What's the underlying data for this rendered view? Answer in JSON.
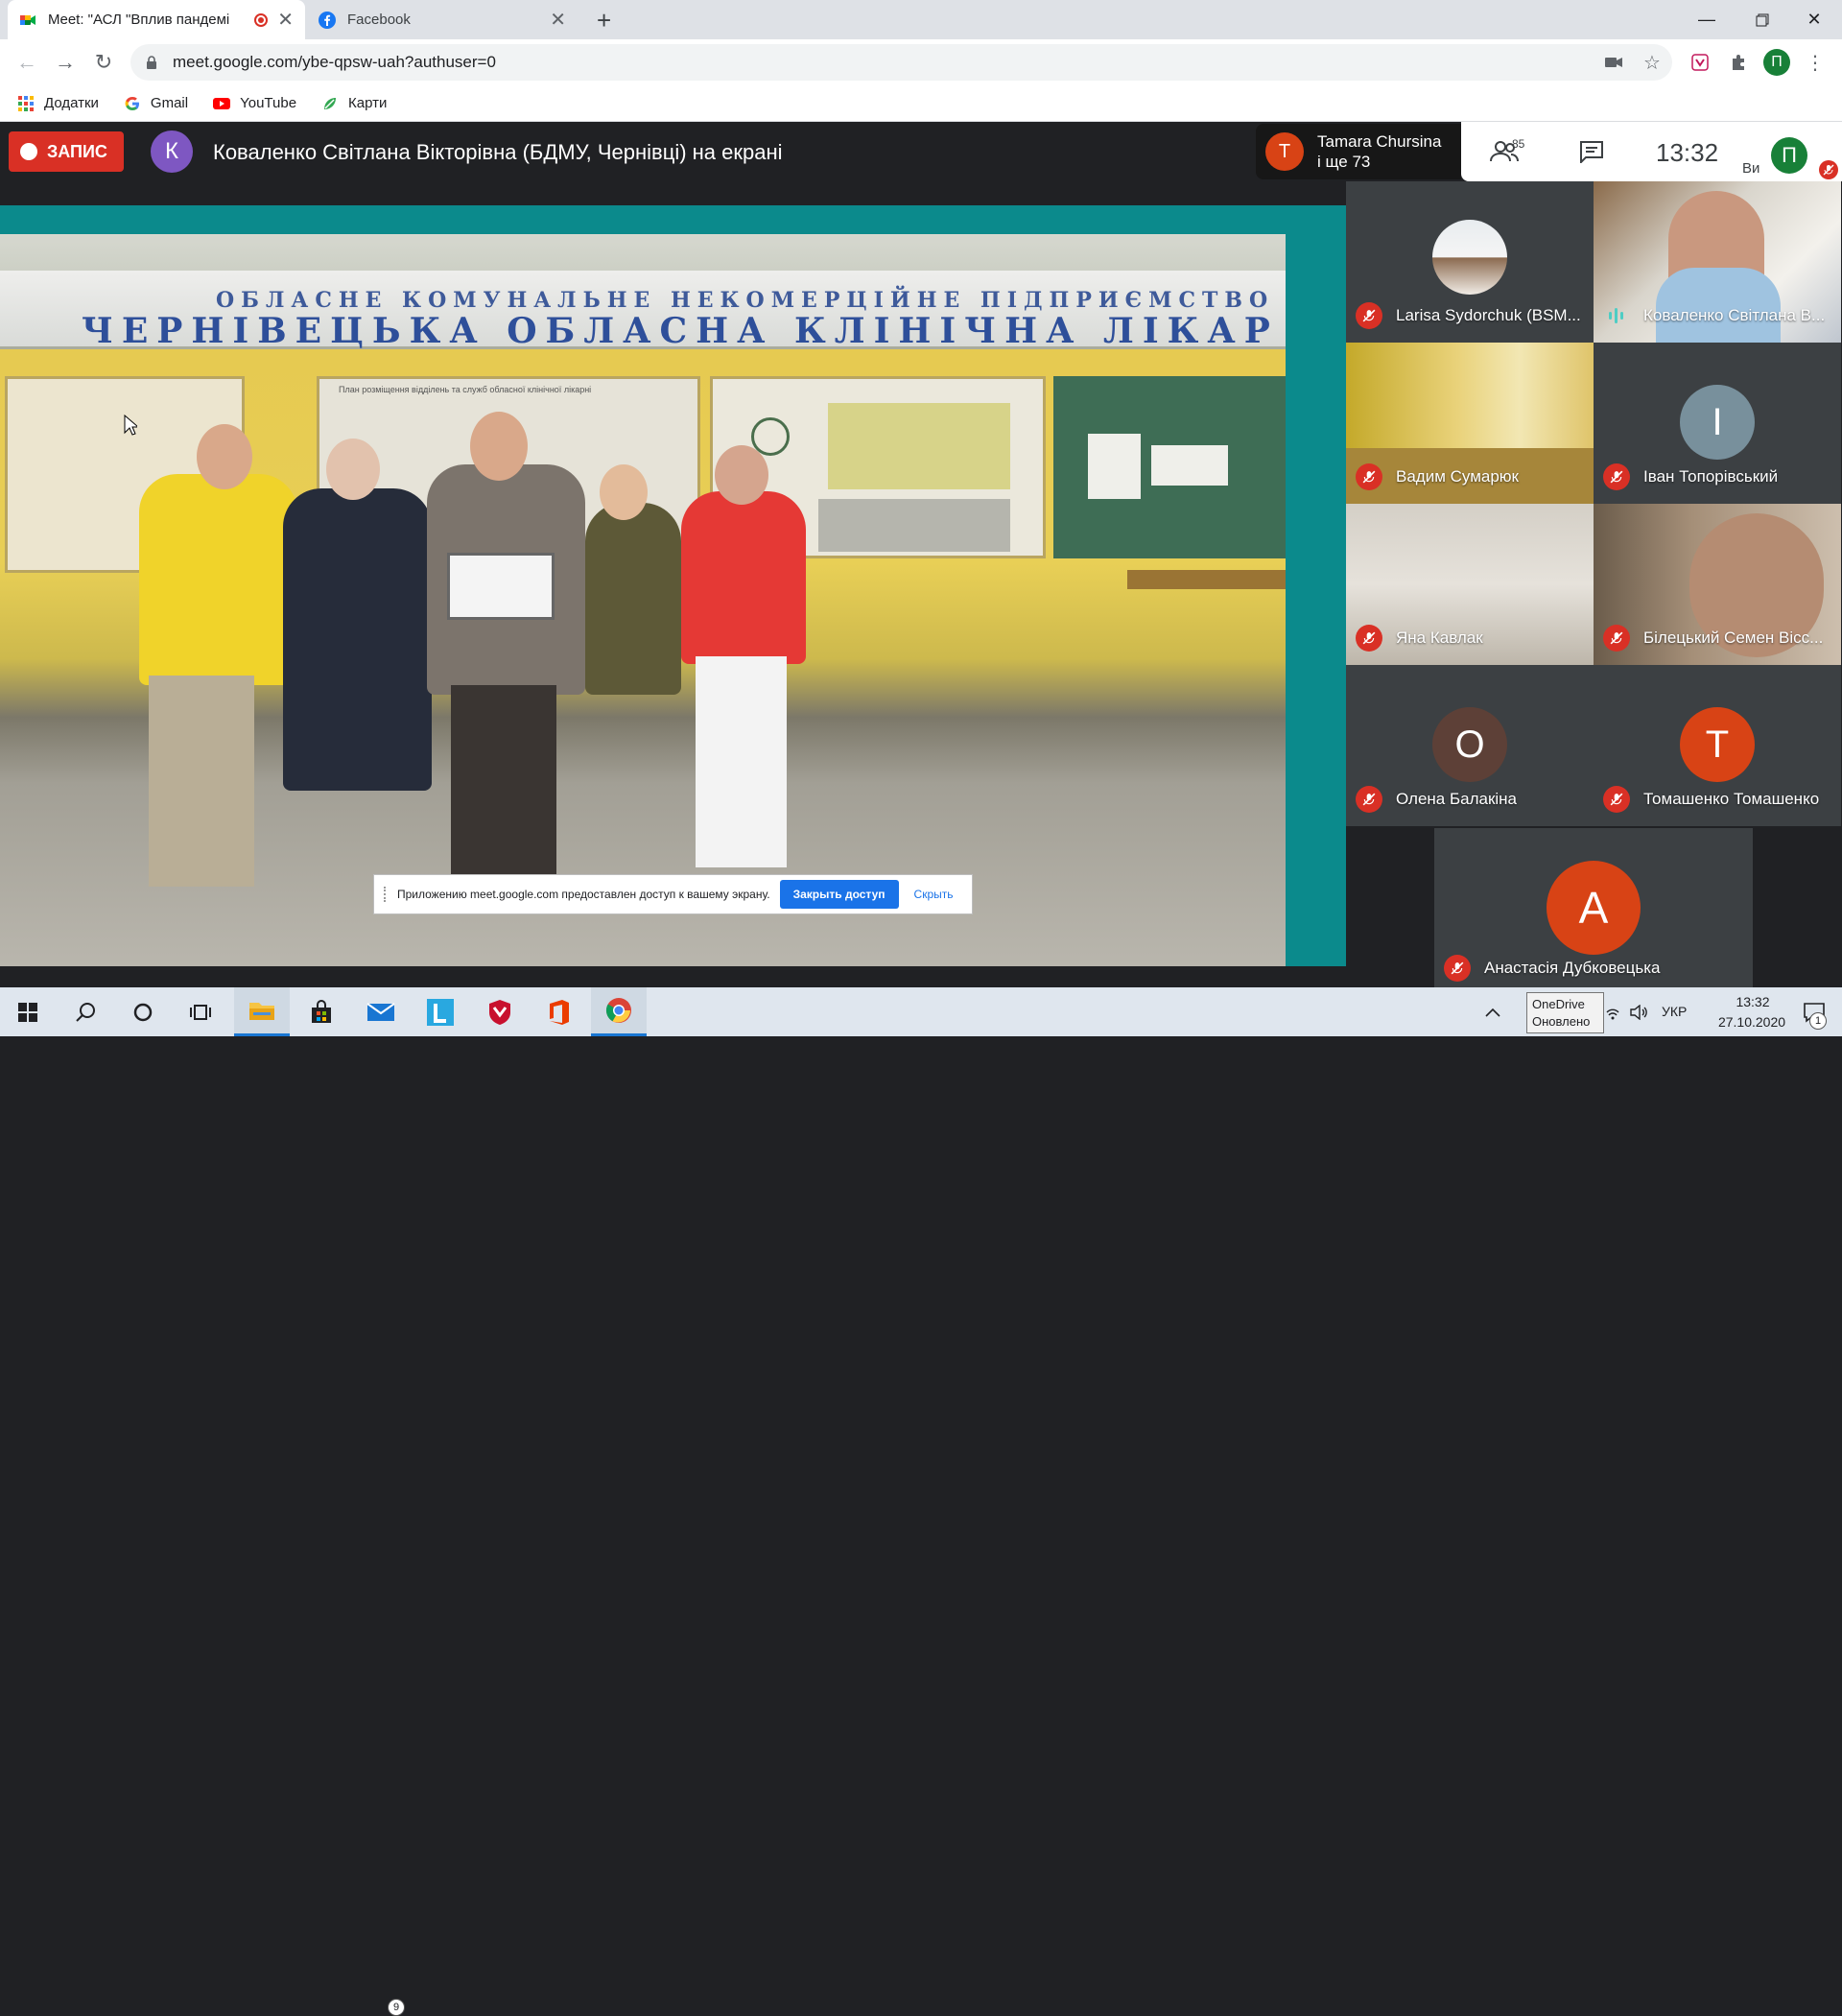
{
  "browser": {
    "tabs": [
      {
        "title": "Meet: \"АСЛ \"Вплив пандемі",
        "recording": true
      },
      {
        "title": "Facebook"
      }
    ],
    "url": "meet.google.com/ybe-qpsw-uah?authuser=0",
    "profile_initial": "П",
    "bookmarks": [
      {
        "label": "Додатки",
        "icon": "apps-grid-icon"
      },
      {
        "label": "Gmail",
        "icon": "google-g-icon"
      },
      {
        "label": "YouTube",
        "icon": "youtube-icon"
      },
      {
        "label": "Карти",
        "icon": "maps-icon"
      }
    ]
  },
  "meet": {
    "record_label": "ЗАПИС",
    "presenter_initial": "К",
    "presenter_title": "Коваленко Світлана Вікторівна (БДМУ, Чернівці) на екрані",
    "people": {
      "initial": "T",
      "name": "Tamara Chursina",
      "more": "і ще 73",
      "count": "85"
    },
    "time": "13:32",
    "you_label": "Ви",
    "self_initial": "П"
  },
  "shared_screen": {
    "sign_line1": "ОБЛАСНЕ КОМУНАЛЬНЕ НЕКОМЕРЦІЙНЕ ПІДПРИЄМСТВО",
    "sign_line2": "ЧЕРНІВЕЦЬКА ОБЛАСНА КЛІНІЧНА ЛІКАР",
    "board_title": "План розміщення відділень та служб обласної клінічної лікарні",
    "share_notice": "Приложению meet.google.com предоставлен доступ к вашему экрану.",
    "stop_sharing": "Закрыть доступ",
    "hide": "Скрыть"
  },
  "participants": [
    {
      "name": "Larisa Sydorchuk (BSM...",
      "muted": true,
      "type": "photo"
    },
    {
      "name": "Коваленко Світлана В...",
      "muted": false,
      "type": "video"
    },
    {
      "name": "Вадим Сумарюк",
      "muted": true,
      "type": "video"
    },
    {
      "name": "Іван Топорівський",
      "muted": true,
      "type": "avatar",
      "initial": "I",
      "color": "#78909c"
    },
    {
      "name": "Яна Кавлак",
      "muted": true,
      "type": "video"
    },
    {
      "name": "Білецький Семен Вісс...",
      "muted": true,
      "type": "video"
    },
    {
      "name": "Олена Балакіна",
      "muted": true,
      "type": "avatar",
      "initial": "О",
      "color": "#5d4037"
    },
    {
      "name": "Томашенко Томашенко",
      "muted": true,
      "type": "avatar",
      "initial": "T",
      "color": "#d84315"
    },
    {
      "name": "Анастасія Дубковецька",
      "muted": true,
      "type": "avatar",
      "initial": "А",
      "color": "#d84315"
    }
  ],
  "taskbar": {
    "mail_badge": "9",
    "tooltip_line1": "OneDrive",
    "tooltip_line2": "Оновлено",
    "language": "УКР",
    "clock_time": "13:32",
    "clock_date": "27.10.2020",
    "notif_count": "1"
  },
  "colors": {
    "meet_dark": "#202124",
    "record_red": "#d93025",
    "tile_bg": "#3c4043",
    "share_teal": "#0b8a8c"
  }
}
